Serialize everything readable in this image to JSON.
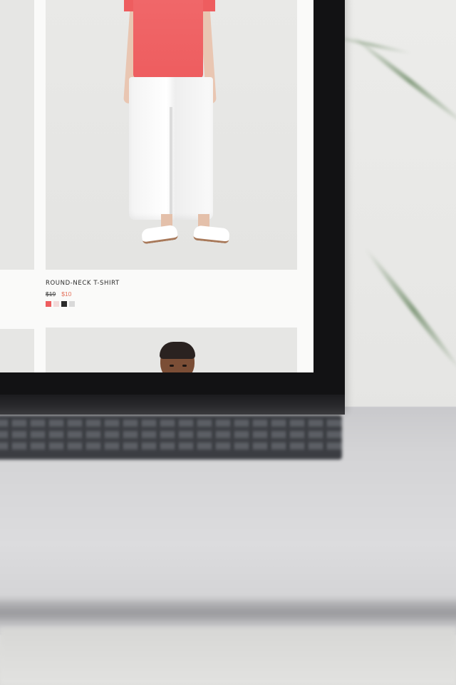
{
  "product": {
    "name": "ROUND-NECK T-SHIRT",
    "price_original": "$19",
    "price_sale": "$10",
    "colors": [
      "#ee5d5f",
      "#f2dada",
      "#2b2b2b",
      "#d9d9d9"
    ]
  }
}
